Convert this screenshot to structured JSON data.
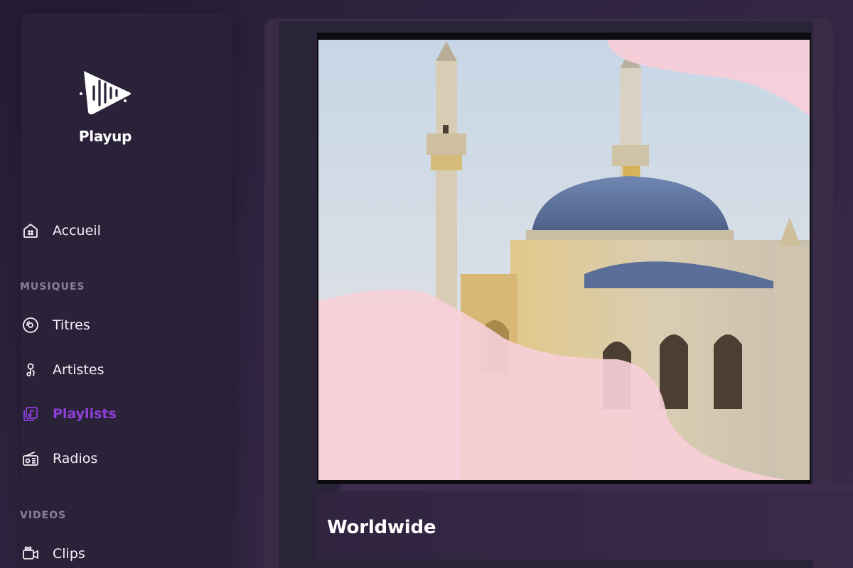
{
  "app": {
    "name": "Playup"
  },
  "sidebar": {
    "home": {
      "label": "Accueil",
      "icon": "home-icon"
    },
    "sections": [
      {
        "title": "MUSIQUES"
      },
      {
        "title": "VIDEOS"
      }
    ],
    "music_items": [
      {
        "label": "Titres",
        "icon": "disc-icon"
      },
      {
        "label": "Artistes",
        "icon": "artist-icon"
      },
      {
        "label": "Playlists",
        "icon": "playlist-icon",
        "active": true
      },
      {
        "label": "Radios",
        "icon": "radio-icon"
      }
    ],
    "video_items": [
      {
        "label": "Clips",
        "icon": "video-camera-icon"
      }
    ]
  },
  "main": {
    "playlist_title": "Worldwide"
  },
  "colors": {
    "accent": "#8e3fd9",
    "sidebar_bg": "#2a2238",
    "wave_pink": "#f7cfd8"
  }
}
